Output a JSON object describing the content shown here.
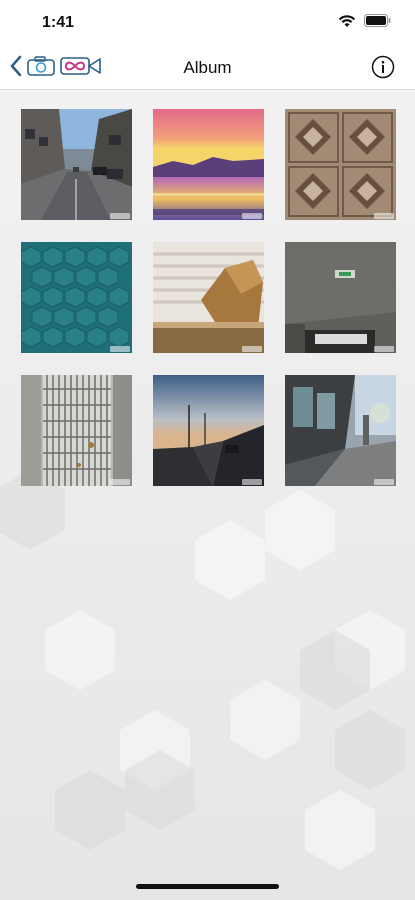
{
  "status_bar": {
    "time": "1:41",
    "icons": [
      "wifi-icon",
      "battery-icon"
    ]
  },
  "nav": {
    "title": "Album",
    "back_icon": "chevron-left-icon",
    "app_icons": [
      "camera-icon",
      "infinity-video-icon"
    ],
    "info_icon": "info-icon",
    "accent_color": "#2a5f86"
  },
  "album": {
    "photos": [
      {
        "name": "street-scene"
      },
      {
        "name": "sunset-over-water"
      },
      {
        "name": "patterned-tiles"
      },
      {
        "name": "teal-hexagon-texture"
      },
      {
        "name": "wooden-object-window"
      },
      {
        "name": "ceiling-exit-sign"
      },
      {
        "name": "metal-drain-grate"
      },
      {
        "name": "dusk-road"
      },
      {
        "name": "shopfront-street"
      }
    ]
  }
}
